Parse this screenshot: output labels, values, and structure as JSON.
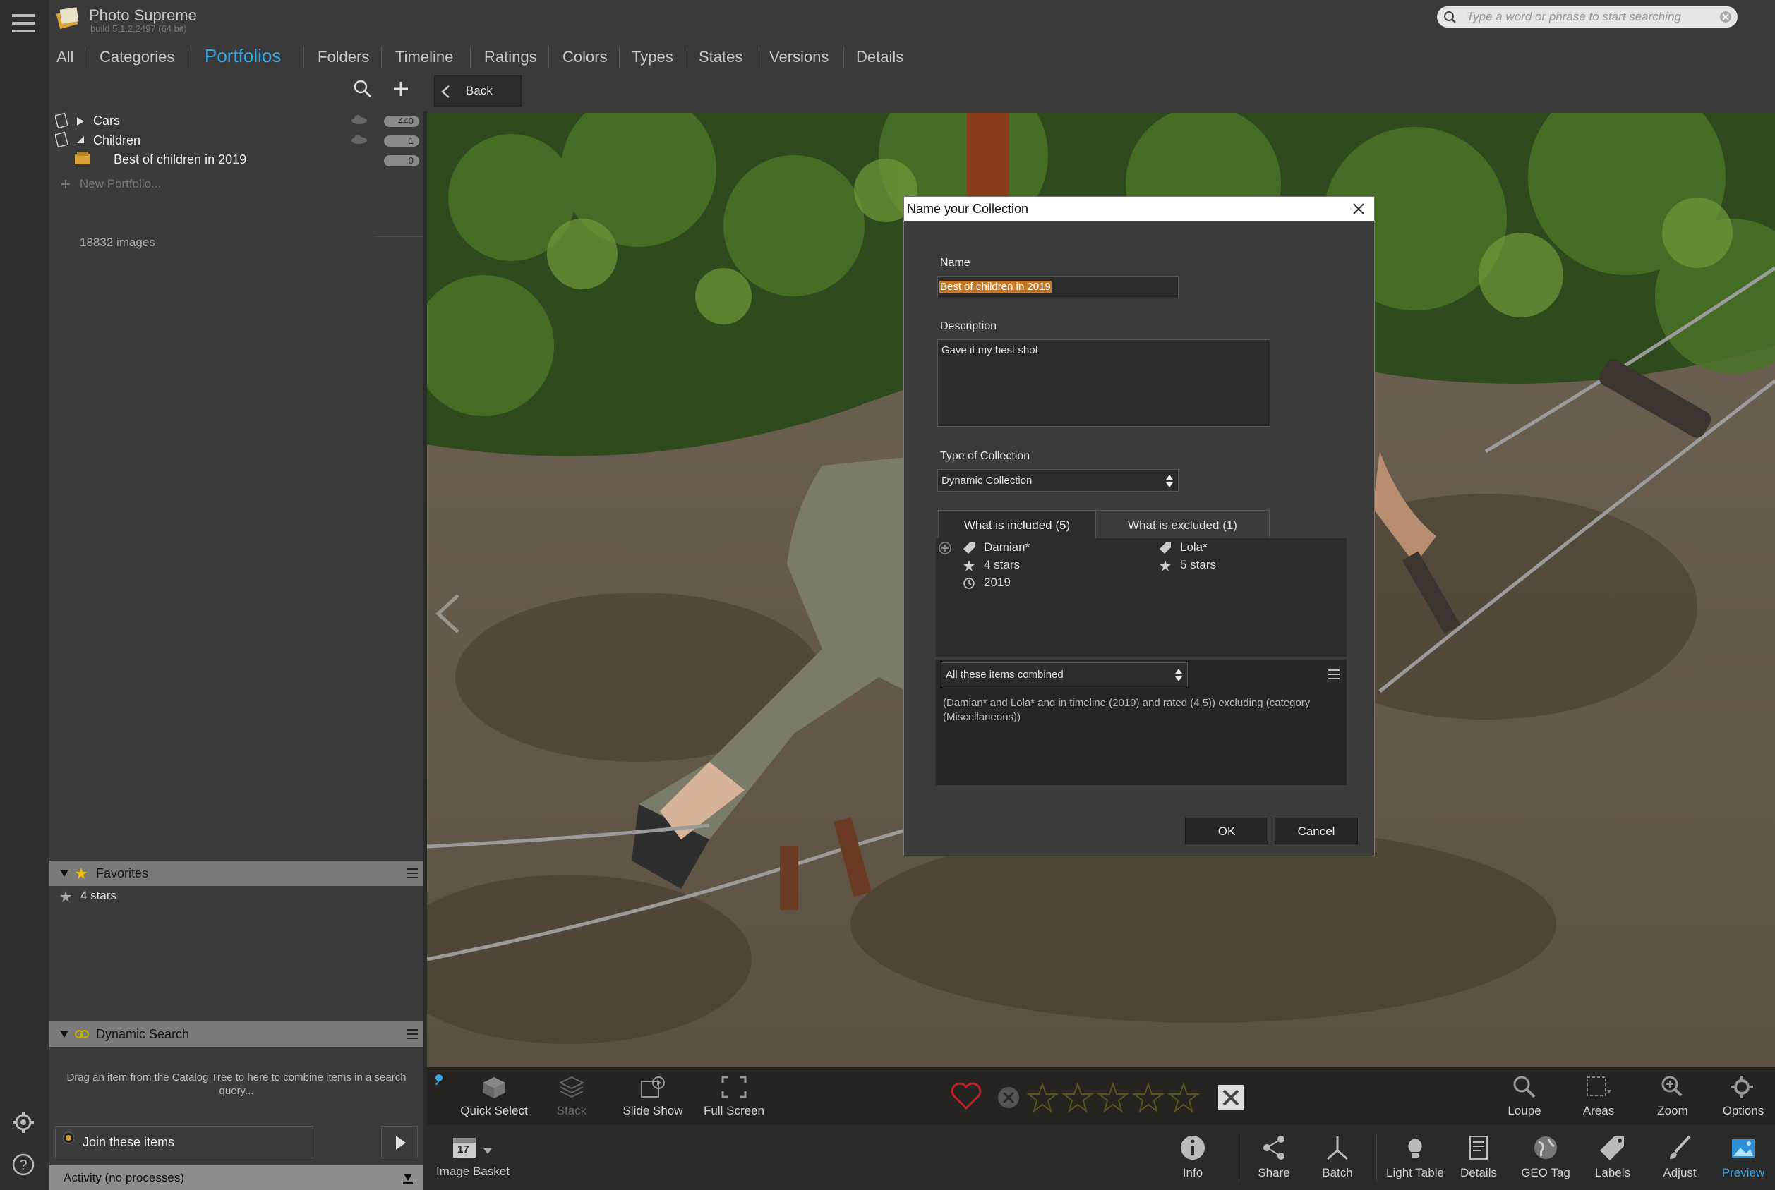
{
  "app": {
    "title": "Photo Supreme",
    "build": "build 5.1.2.2497 (64 bit)"
  },
  "search": {
    "placeholder": "Type a word or phrase to start searching"
  },
  "nav": {
    "tabs": [
      "All",
      "Categories",
      "Portfolios",
      "Folders",
      "Timeline",
      "Ratings",
      "Colors",
      "Types",
      "States",
      "Versions",
      "Details"
    ],
    "active": "Portfolios"
  },
  "toolbar": {
    "back_label": "Back"
  },
  "tree": {
    "items": [
      {
        "label": "Cars",
        "count": "440"
      },
      {
        "label": "Children",
        "count": "1"
      },
      {
        "label": "Best of children in 2019",
        "count": "0"
      }
    ],
    "new_portfolio": "New Portfolio...",
    "image_count": "18832 images"
  },
  "favorites": {
    "title": "Favorites",
    "items": [
      "4 stars"
    ]
  },
  "dynamic_search": {
    "title": "Dynamic Search",
    "hint": "Drag an item from the Catalog Tree to here to combine items in a search query...",
    "join_label": "Join these items"
  },
  "activity": {
    "label": "Activity (no processes)"
  },
  "dialog": {
    "title": "Name your Collection",
    "name_label": "Name",
    "name_value": "Best of children in 2019",
    "description_label": "Description",
    "description_value": "Gave it my best shot",
    "type_label": "Type of Collection",
    "type_value": "Dynamic Collection",
    "tab_included": "What is included (5)",
    "tab_excluded": "What is excluded (1)",
    "included": [
      "Damian*",
      "4 stars",
      "2019"
    ],
    "included_right": [
      "Lola*",
      "5 stars"
    ],
    "combine_value": "All these items combined",
    "query_text": "(Damian* and Lola* and in timeline (2019) and rated  (4,5)) excluding (category (Miscellaneous))",
    "ok_label": "OK",
    "cancel_label": "Cancel"
  },
  "strip_buttons": [
    "Quick Select",
    "Stack",
    "Slide Show",
    "Full Screen",
    "Loupe",
    "Areas",
    "Zoom",
    "Options"
  ],
  "bottom_buttons": [
    "Image Basket",
    "Info",
    "Share",
    "Batch",
    "Light Table",
    "Details",
    "GEO Tag",
    "Labels",
    "Adjust",
    "Preview"
  ],
  "calendar_day": "17",
  "colors": {
    "accent": "#3aa6e4",
    "active_preview": "#2f8fd6"
  }
}
